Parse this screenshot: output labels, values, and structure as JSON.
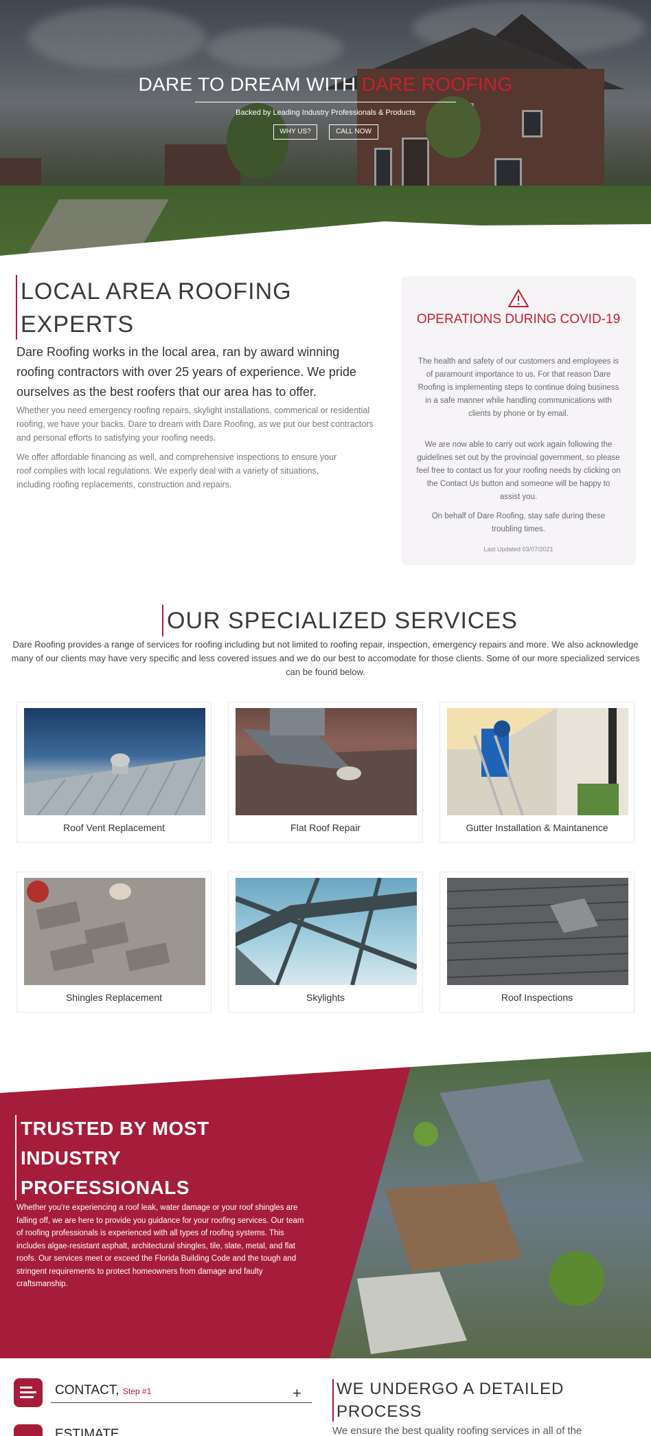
{
  "hero": {
    "title_main": "DARE TO DREAM WITH ",
    "title_accent": "DARE ROOFING",
    "subtitle": "Backed by Leading Industry Professionals & Products",
    "btn_why": "WHY US?",
    "btn_call": "CALL NOW"
  },
  "local": {
    "heading_line1": "LOCAL AREA ROOFING",
    "heading_line2": "EXPERTS",
    "lead": "Dare Roofing works in the local area, ran by award winning roofing contractors with over 25 years of experience. We pride ourselves as the best roofers that our area has to offer.",
    "para1": "Whether you need emergency roofing repairs, skylight installations, commerical or residential roofing, we have your backs. Dare to dream with Dare Roofing, as we put our best contractors and personal efforts to satisfying your roofing needs.",
    "para2": "We offer affordable financing as well, and comprehensive inspections to ensure your roof complies with local regulations. We experly deal with a variety of situations, including roofing replacements, construction and repairs."
  },
  "covid": {
    "icon": "warning-triangle-icon",
    "title": "OPERATIONS DURING COVID-19",
    "p1": "The health and safety of our customers and employees is of paramount importance to us. For that reason Dare Roofing is implementing steps to continue doing business in a safe manner while handling communications with clients by phone or by email.",
    "p2": "We are now able to carry out work again following the guidelines set out by the provincial government, so please feel free to contact us for your roofing needs by clicking on the Contact Us button and someone will be happy to assist you.",
    "p3": "On behalf of Dare Roofing, stay safe during these troubling times.",
    "updated": "Last Updated 03/07/2021"
  },
  "services": {
    "heading": "OUR SPECIALIZED SERVICES",
    "intro": "Dare Roofing provides a range of services for roofing including but not limited to roofing repair, inspection, emergency repairs and more. We also acknowledge many of our clients may have very specific and less covered issues and we do our best to accomodate for those clients. Some of our more specialized services can be found below.",
    "cards": [
      {
        "label": "Roof Vent Replacement"
      },
      {
        "label": "Flat Roof Repair"
      },
      {
        "label": "Gutter Installation & Maintanence"
      },
      {
        "label": "Shingles Replacement"
      },
      {
        "label": "Skylights"
      },
      {
        "label": "Roof Inspections"
      }
    ]
  },
  "trusted": {
    "heading": "TRUSTED BY MOST INDUSTRY PROFESSIONALS",
    "body": "Whether you're experiencing a roof leak, water damage or your roof shingles are falling off, we are here to provide you guidance for your roofing services. Our team of roofing professionals is experienced with all types of roofing systems. This includes algae-resistant asphalt, architectural shingles, tile, slate, metal, and flat roofs. Our services meet or exceed the Florida Building Code and the tough and stringent requirements to protect homeowners from damage and faulty craftsmanship."
  },
  "contact": {
    "title": "CONTACT,",
    "step": "Step #1",
    "estimate": "ESTIMATE"
  },
  "process": {
    "heading": "WE UNDERGO A DETAILED PROCESS",
    "body": "We ensure the best quality roofing services in all of the"
  },
  "colors": {
    "accent": "#c8202f",
    "brand": "#a51d3a"
  }
}
